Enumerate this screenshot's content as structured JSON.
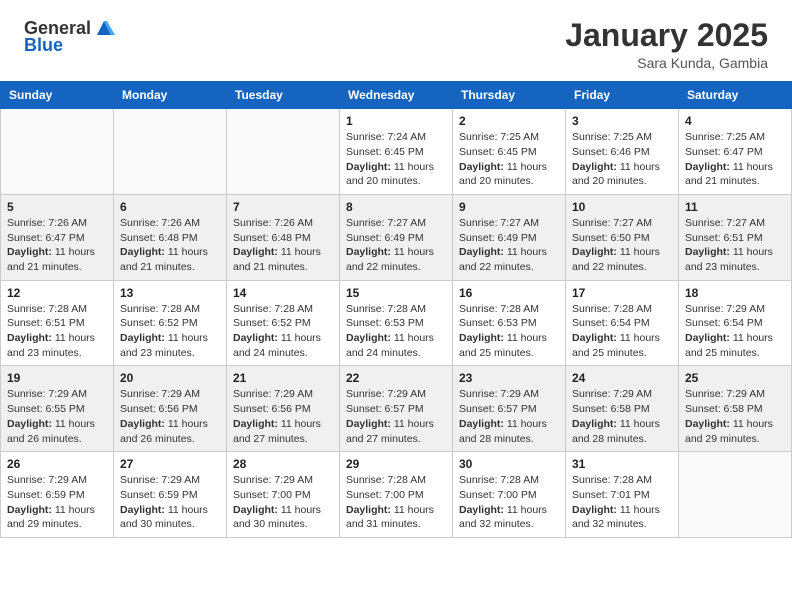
{
  "header": {
    "logo_general": "General",
    "logo_blue": "Blue",
    "month": "January 2025",
    "location": "Sara Kunda, Gambia"
  },
  "weekdays": [
    "Sunday",
    "Monday",
    "Tuesday",
    "Wednesday",
    "Thursday",
    "Friday",
    "Saturday"
  ],
  "weeks": [
    [
      {
        "day": "",
        "info": ""
      },
      {
        "day": "",
        "info": ""
      },
      {
        "day": "",
        "info": ""
      },
      {
        "day": "1",
        "info": "Sunrise: 7:24 AM\nSunset: 6:45 PM\nDaylight: 11 hours and 20 minutes."
      },
      {
        "day": "2",
        "info": "Sunrise: 7:25 AM\nSunset: 6:45 PM\nDaylight: 11 hours and 20 minutes."
      },
      {
        "day": "3",
        "info": "Sunrise: 7:25 AM\nSunset: 6:46 PM\nDaylight: 11 hours and 20 minutes."
      },
      {
        "day": "4",
        "info": "Sunrise: 7:25 AM\nSunset: 6:47 PM\nDaylight: 11 hours and 21 minutes."
      }
    ],
    [
      {
        "day": "5",
        "info": "Sunrise: 7:26 AM\nSunset: 6:47 PM\nDaylight: 11 hours and 21 minutes."
      },
      {
        "day": "6",
        "info": "Sunrise: 7:26 AM\nSunset: 6:48 PM\nDaylight: 11 hours and 21 minutes."
      },
      {
        "day": "7",
        "info": "Sunrise: 7:26 AM\nSunset: 6:48 PM\nDaylight: 11 hours and 21 minutes."
      },
      {
        "day": "8",
        "info": "Sunrise: 7:27 AM\nSunset: 6:49 PM\nDaylight: 11 hours and 22 minutes."
      },
      {
        "day": "9",
        "info": "Sunrise: 7:27 AM\nSunset: 6:49 PM\nDaylight: 11 hours and 22 minutes."
      },
      {
        "day": "10",
        "info": "Sunrise: 7:27 AM\nSunset: 6:50 PM\nDaylight: 11 hours and 22 minutes."
      },
      {
        "day": "11",
        "info": "Sunrise: 7:27 AM\nSunset: 6:51 PM\nDaylight: 11 hours and 23 minutes."
      }
    ],
    [
      {
        "day": "12",
        "info": "Sunrise: 7:28 AM\nSunset: 6:51 PM\nDaylight: 11 hours and 23 minutes."
      },
      {
        "day": "13",
        "info": "Sunrise: 7:28 AM\nSunset: 6:52 PM\nDaylight: 11 hours and 23 minutes."
      },
      {
        "day": "14",
        "info": "Sunrise: 7:28 AM\nSunset: 6:52 PM\nDaylight: 11 hours and 24 minutes."
      },
      {
        "day": "15",
        "info": "Sunrise: 7:28 AM\nSunset: 6:53 PM\nDaylight: 11 hours and 24 minutes."
      },
      {
        "day": "16",
        "info": "Sunrise: 7:28 AM\nSunset: 6:53 PM\nDaylight: 11 hours and 25 minutes."
      },
      {
        "day": "17",
        "info": "Sunrise: 7:28 AM\nSunset: 6:54 PM\nDaylight: 11 hours and 25 minutes."
      },
      {
        "day": "18",
        "info": "Sunrise: 7:29 AM\nSunset: 6:54 PM\nDaylight: 11 hours and 25 minutes."
      }
    ],
    [
      {
        "day": "19",
        "info": "Sunrise: 7:29 AM\nSunset: 6:55 PM\nDaylight: 11 hours and 26 minutes."
      },
      {
        "day": "20",
        "info": "Sunrise: 7:29 AM\nSunset: 6:56 PM\nDaylight: 11 hours and 26 minutes."
      },
      {
        "day": "21",
        "info": "Sunrise: 7:29 AM\nSunset: 6:56 PM\nDaylight: 11 hours and 27 minutes."
      },
      {
        "day": "22",
        "info": "Sunrise: 7:29 AM\nSunset: 6:57 PM\nDaylight: 11 hours and 27 minutes."
      },
      {
        "day": "23",
        "info": "Sunrise: 7:29 AM\nSunset: 6:57 PM\nDaylight: 11 hours and 28 minutes."
      },
      {
        "day": "24",
        "info": "Sunrise: 7:29 AM\nSunset: 6:58 PM\nDaylight: 11 hours and 28 minutes."
      },
      {
        "day": "25",
        "info": "Sunrise: 7:29 AM\nSunset: 6:58 PM\nDaylight: 11 hours and 29 minutes."
      }
    ],
    [
      {
        "day": "26",
        "info": "Sunrise: 7:29 AM\nSunset: 6:59 PM\nDaylight: 11 hours and 29 minutes."
      },
      {
        "day": "27",
        "info": "Sunrise: 7:29 AM\nSunset: 6:59 PM\nDaylight: 11 hours and 30 minutes."
      },
      {
        "day": "28",
        "info": "Sunrise: 7:29 AM\nSunset: 7:00 PM\nDaylight: 11 hours and 30 minutes."
      },
      {
        "day": "29",
        "info": "Sunrise: 7:28 AM\nSunset: 7:00 PM\nDaylight: 11 hours and 31 minutes."
      },
      {
        "day": "30",
        "info": "Sunrise: 7:28 AM\nSunset: 7:00 PM\nDaylight: 11 hours and 32 minutes."
      },
      {
        "day": "31",
        "info": "Sunrise: 7:28 AM\nSunset: 7:01 PM\nDaylight: 11 hours and 32 minutes."
      },
      {
        "day": "",
        "info": ""
      }
    ]
  ]
}
